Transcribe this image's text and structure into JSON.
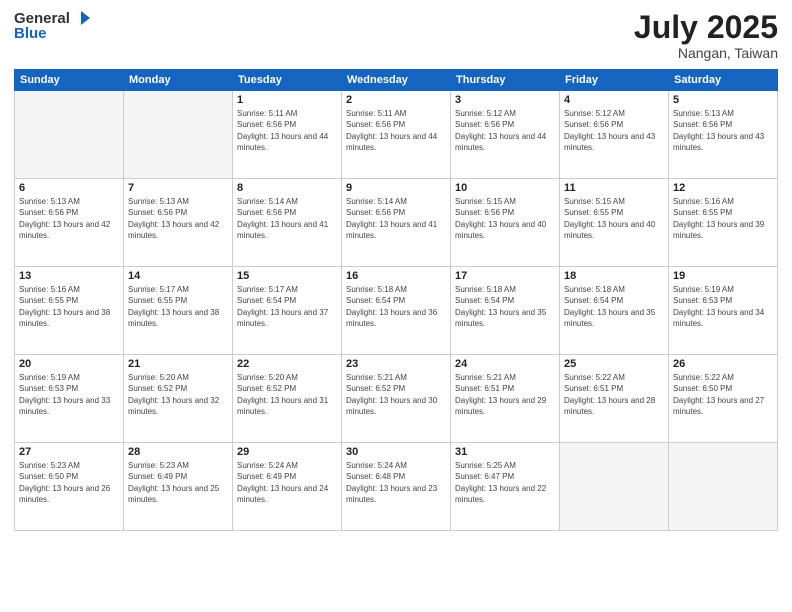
{
  "header": {
    "logo_line1": "General",
    "logo_line2": "Blue",
    "month": "July 2025",
    "location": "Nangan, Taiwan"
  },
  "weekdays": [
    "Sunday",
    "Monday",
    "Tuesday",
    "Wednesday",
    "Thursday",
    "Friday",
    "Saturday"
  ],
  "weeks": [
    [
      {
        "day": "",
        "empty": true
      },
      {
        "day": "",
        "empty": true
      },
      {
        "day": "1",
        "sunrise": "5:11 AM",
        "sunset": "6:56 PM",
        "daylight": "13 hours and 44 minutes."
      },
      {
        "day": "2",
        "sunrise": "5:11 AM",
        "sunset": "6:56 PM",
        "daylight": "13 hours and 44 minutes."
      },
      {
        "day": "3",
        "sunrise": "5:12 AM",
        "sunset": "6:56 PM",
        "daylight": "13 hours and 44 minutes."
      },
      {
        "day": "4",
        "sunrise": "5:12 AM",
        "sunset": "6:56 PM",
        "daylight": "13 hours and 43 minutes."
      },
      {
        "day": "5",
        "sunrise": "5:13 AM",
        "sunset": "6:56 PM",
        "daylight": "13 hours and 43 minutes."
      }
    ],
    [
      {
        "day": "6",
        "sunrise": "5:13 AM",
        "sunset": "6:56 PM",
        "daylight": "13 hours and 42 minutes."
      },
      {
        "day": "7",
        "sunrise": "5:13 AM",
        "sunset": "6:56 PM",
        "daylight": "13 hours and 42 minutes."
      },
      {
        "day": "8",
        "sunrise": "5:14 AM",
        "sunset": "6:56 PM",
        "daylight": "13 hours and 41 minutes."
      },
      {
        "day": "9",
        "sunrise": "5:14 AM",
        "sunset": "6:56 PM",
        "daylight": "13 hours and 41 minutes."
      },
      {
        "day": "10",
        "sunrise": "5:15 AM",
        "sunset": "6:56 PM",
        "daylight": "13 hours and 40 minutes."
      },
      {
        "day": "11",
        "sunrise": "5:15 AM",
        "sunset": "6:55 PM",
        "daylight": "13 hours and 40 minutes."
      },
      {
        "day": "12",
        "sunrise": "5:16 AM",
        "sunset": "6:55 PM",
        "daylight": "13 hours and 39 minutes."
      }
    ],
    [
      {
        "day": "13",
        "sunrise": "5:16 AM",
        "sunset": "6:55 PM",
        "daylight": "13 hours and 38 minutes."
      },
      {
        "day": "14",
        "sunrise": "5:17 AM",
        "sunset": "6:55 PM",
        "daylight": "13 hours and 38 minutes."
      },
      {
        "day": "15",
        "sunrise": "5:17 AM",
        "sunset": "6:54 PM",
        "daylight": "13 hours and 37 minutes."
      },
      {
        "day": "16",
        "sunrise": "5:18 AM",
        "sunset": "6:54 PM",
        "daylight": "13 hours and 36 minutes."
      },
      {
        "day": "17",
        "sunrise": "5:18 AM",
        "sunset": "6:54 PM",
        "daylight": "13 hours and 35 minutes."
      },
      {
        "day": "18",
        "sunrise": "5:18 AM",
        "sunset": "6:54 PM",
        "daylight": "13 hours and 35 minutes."
      },
      {
        "day": "19",
        "sunrise": "5:19 AM",
        "sunset": "6:53 PM",
        "daylight": "13 hours and 34 minutes."
      }
    ],
    [
      {
        "day": "20",
        "sunrise": "5:19 AM",
        "sunset": "6:53 PM",
        "daylight": "13 hours and 33 minutes."
      },
      {
        "day": "21",
        "sunrise": "5:20 AM",
        "sunset": "6:52 PM",
        "daylight": "13 hours and 32 minutes."
      },
      {
        "day": "22",
        "sunrise": "5:20 AM",
        "sunset": "6:52 PM",
        "daylight": "13 hours and 31 minutes."
      },
      {
        "day": "23",
        "sunrise": "5:21 AM",
        "sunset": "6:52 PM",
        "daylight": "13 hours and 30 minutes."
      },
      {
        "day": "24",
        "sunrise": "5:21 AM",
        "sunset": "6:51 PM",
        "daylight": "13 hours and 29 minutes."
      },
      {
        "day": "25",
        "sunrise": "5:22 AM",
        "sunset": "6:51 PM",
        "daylight": "13 hours and 28 minutes."
      },
      {
        "day": "26",
        "sunrise": "5:22 AM",
        "sunset": "6:50 PM",
        "daylight": "13 hours and 27 minutes."
      }
    ],
    [
      {
        "day": "27",
        "sunrise": "5:23 AM",
        "sunset": "6:50 PM",
        "daylight": "13 hours and 26 minutes."
      },
      {
        "day": "28",
        "sunrise": "5:23 AM",
        "sunset": "6:49 PM",
        "daylight": "13 hours and 25 minutes."
      },
      {
        "day": "29",
        "sunrise": "5:24 AM",
        "sunset": "6:49 PM",
        "daylight": "13 hours and 24 minutes."
      },
      {
        "day": "30",
        "sunrise": "5:24 AM",
        "sunset": "6:48 PM",
        "daylight": "13 hours and 23 minutes."
      },
      {
        "day": "31",
        "sunrise": "5:25 AM",
        "sunset": "6:47 PM",
        "daylight": "13 hours and 22 minutes."
      },
      {
        "day": "",
        "empty": true
      },
      {
        "day": "",
        "empty": true
      }
    ]
  ]
}
